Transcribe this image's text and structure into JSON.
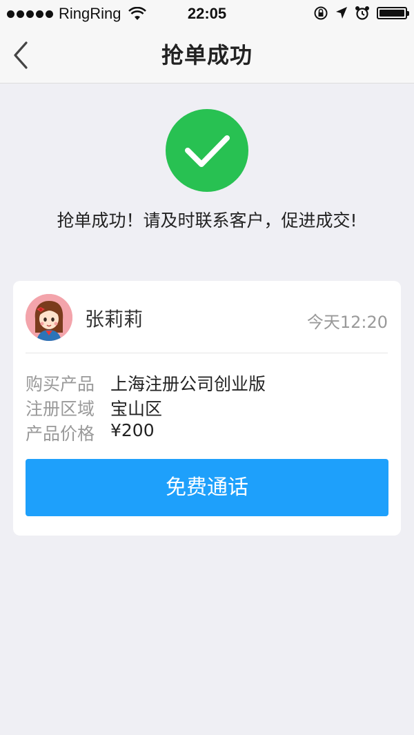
{
  "status_bar": {
    "carrier": "RingRing",
    "time": "22:05"
  },
  "nav": {
    "title": "抢单成功",
    "back_icon": "chevron-left-icon"
  },
  "success": {
    "icon": "checkmark-icon",
    "message": "抢单成功！请及时联系客户，促进成交!"
  },
  "order": {
    "customer_name": "张莉莉",
    "time": "今天12:20",
    "rows": [
      {
        "label": "购买产品",
        "value": "上海注册公司创业版"
      },
      {
        "label": "注册区域",
        "value": "宝山区"
      },
      {
        "label": "产品价格",
        "value": "¥200"
      }
    ],
    "call_button": "免费通话"
  },
  "colors": {
    "success_green": "#28c152",
    "button_blue": "#1ea0fb",
    "background": "#efeff4"
  }
}
